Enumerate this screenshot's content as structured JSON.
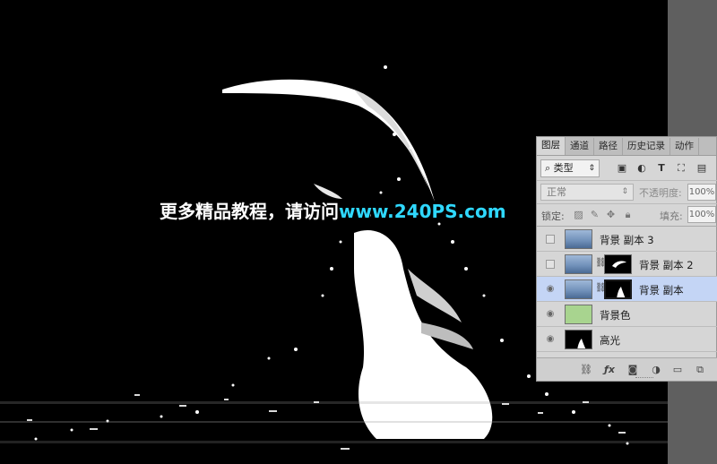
{
  "watermark": {
    "cn_text": "更多精品教程，请访问",
    "url": "www.240PS.com"
  },
  "colors": {
    "accent_url": "#2fd8ff",
    "selected_layer": "#c4d5f5",
    "green_swatch": "#a8d48f",
    "panel_bg": "#d6d6d6"
  },
  "layers_panel": {
    "tabs": [
      "图层",
      "通道",
      "路径",
      "历史记录",
      "动作"
    ],
    "active_tab": "图层",
    "filter": {
      "value": "类型",
      "icons": [
        "image-filter-icon",
        "adjustment-filter-icon",
        "type-filter-icon",
        "shape-filter-icon",
        "smart-object-filter-icon"
      ]
    },
    "blend_mode": "正常",
    "opacity_label": "不透明度:",
    "opacity_value": "100%",
    "lock_label": "锁定:",
    "fill_label": "填充:",
    "fill_value": "100%",
    "layers": [
      {
        "name": "背景 副本 3",
        "visible": false,
        "thumb": "photo",
        "has_mask": false,
        "selected": false
      },
      {
        "name": "背景 副本 2",
        "visible": false,
        "thumb": "photo",
        "has_mask": true,
        "selected": false
      },
      {
        "name": "背景 副本",
        "visible": true,
        "thumb": "photo",
        "has_mask": true,
        "selected": true
      },
      {
        "name": "背景色",
        "visible": true,
        "thumb": "green",
        "has_mask": false,
        "selected": false
      },
      {
        "name": "高光",
        "visible": true,
        "thumb": "black",
        "has_mask": false,
        "selected": false
      }
    ],
    "bottom_icons": [
      "link-layers-icon",
      "fx-icon",
      "add-mask-icon",
      "adjustment-layer-icon",
      "new-group-icon",
      "new-layer-icon"
    ]
  }
}
